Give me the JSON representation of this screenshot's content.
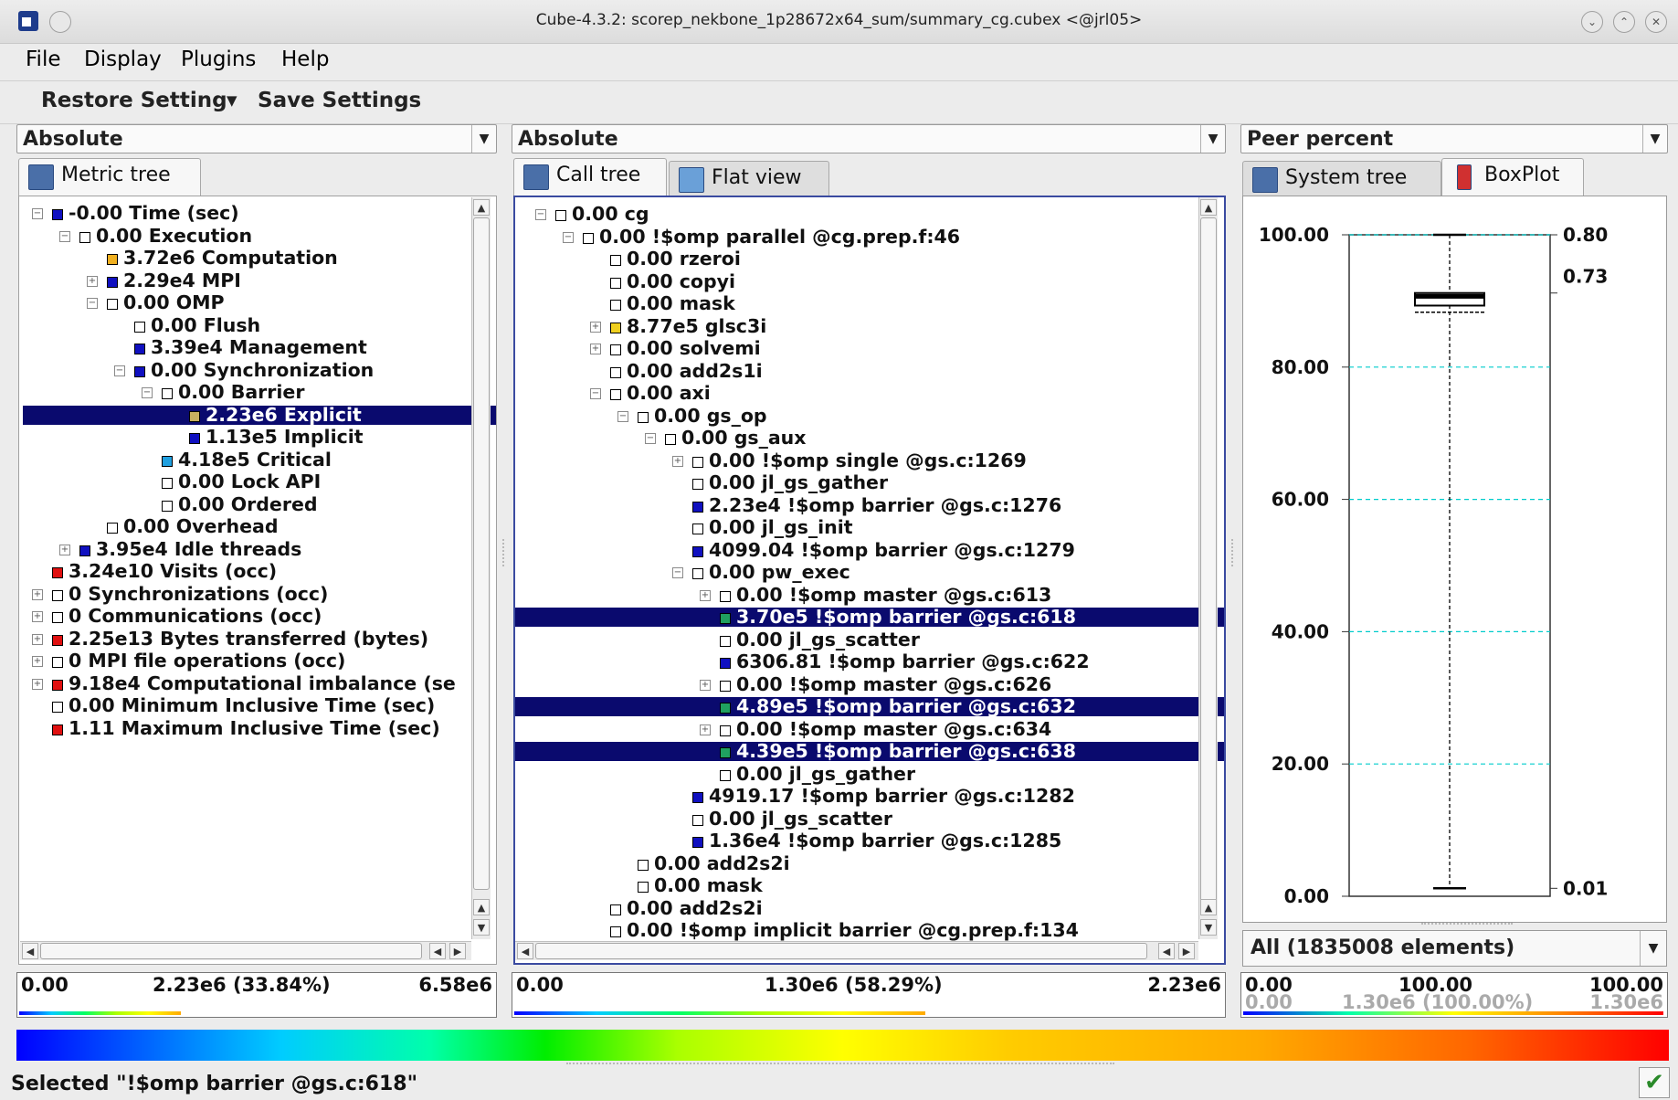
{
  "window": {
    "title": "Cube-4.3.2: scorep_nekbone_1p28672x64_sum/summary_cg.cubex <@jrl05>"
  },
  "menu": [
    "File",
    "Display",
    "Plugins",
    "Help"
  ],
  "toolbar": {
    "restore": "Restore Setting",
    "save": "Save Settings"
  },
  "metric_panel": {
    "mode": "Absolute",
    "tab": "Metric tree",
    "rows": [
      {
        "text": "-0.00 Time (sec)",
        "level": 0,
        "exp": "-",
        "color": "#1010c0"
      },
      {
        "text": "0.00 Execution",
        "level": 1,
        "exp": "-",
        "color": "#ffffff"
      },
      {
        "text": "3.72e6 Computation",
        "level": 2,
        "exp": "",
        "color": "#f0b020"
      },
      {
        "text": "2.29e4 MPI",
        "level": 2,
        "exp": "+",
        "color": "#1010c0"
      },
      {
        "text": "0.00 OMP",
        "level": 2,
        "exp": "-",
        "color": "#ffffff"
      },
      {
        "text": "0.00 Flush",
        "level": 3,
        "exp": "",
        "color": "#ffffff"
      },
      {
        "text": "3.39e4 Management",
        "level": 3,
        "exp": "",
        "color": "#1010c0"
      },
      {
        "text": "0.00 Synchronization",
        "level": 3,
        "exp": "-",
        "color": "#1010c0"
      },
      {
        "text": "0.00 Barrier",
        "level": 4,
        "exp": "-",
        "color": "#ffffff"
      },
      {
        "text": "2.23e6 Explicit",
        "level": 5,
        "exp": "",
        "color": "#c8b060",
        "selected": true
      },
      {
        "text": "1.13e5 Implicit",
        "level": 5,
        "exp": "",
        "color": "#1010c0"
      },
      {
        "text": "4.18e5 Critical",
        "level": 4,
        "exp": "",
        "color": "#20a0e0"
      },
      {
        "text": "0.00 Lock API",
        "level": 4,
        "exp": "",
        "color": "#ffffff"
      },
      {
        "text": "0.00 Ordered",
        "level": 4,
        "exp": "",
        "color": "#ffffff"
      },
      {
        "text": "0.00 Overhead",
        "level": 2,
        "exp": "",
        "color": "#ffffff"
      },
      {
        "text": "3.95e4 Idle threads",
        "level": 1,
        "exp": "+",
        "color": "#1010c0"
      },
      {
        "text": "3.24e10 Visits (occ)",
        "level": 0,
        "exp": "",
        "color": "#e01010"
      },
      {
        "text": "0 Synchronizations (occ)",
        "level": 0,
        "exp": "+",
        "color": "#ffffff"
      },
      {
        "text": "0 Communications (occ)",
        "level": 0,
        "exp": "+",
        "color": "#ffffff"
      },
      {
        "text": "2.25e13 Bytes transferred (bytes)",
        "level": 0,
        "exp": "+",
        "color": "#e01010"
      },
      {
        "text": "0 MPI file operations (occ)",
        "level": 0,
        "exp": "+",
        "color": "#ffffff"
      },
      {
        "text": "9.18e4 Computational imbalance (se",
        "level": 0,
        "exp": "+",
        "color": "#e01010"
      },
      {
        "text": "0.00 Minimum Inclusive Time (sec)",
        "level": 0,
        "exp": "",
        "color": "#ffffff"
      },
      {
        "text": "1.11 Maximum Inclusive Time (sec)",
        "level": 0,
        "exp": "",
        "color": "#e01010"
      }
    ],
    "scale": {
      "min": "0.00",
      "mid": "2.23e6 (33.84%)",
      "max": "6.58e6",
      "fill": 0.34
    }
  },
  "call_panel": {
    "mode": "Absolute",
    "tabs": [
      "Call tree",
      "Flat view"
    ],
    "rows": [
      {
        "text": "0.00 cg",
        "level": 0,
        "exp": "-",
        "color": "#ffffff"
      },
      {
        "text": "0.00 !$omp parallel @cg.prep.f:46",
        "level": 1,
        "exp": "-",
        "color": "#ffffff"
      },
      {
        "text": "0.00 rzeroi",
        "level": 2,
        "exp": "",
        "color": "#ffffff"
      },
      {
        "text": "0.00 copyi",
        "level": 2,
        "exp": "",
        "color": "#ffffff"
      },
      {
        "text": "0.00 mask",
        "level": 2,
        "exp": "",
        "color": "#ffffff"
      },
      {
        "text": "8.77e5 glsc3i",
        "level": 2,
        "exp": "+",
        "color": "#f0d020"
      },
      {
        "text": "0.00 solvemi",
        "level": 2,
        "exp": "+",
        "color": "#ffffff"
      },
      {
        "text": "0.00 add2s1i",
        "level": 2,
        "exp": "",
        "color": "#ffffff"
      },
      {
        "text": "0.00 axi",
        "level": 2,
        "exp": "-",
        "color": "#ffffff"
      },
      {
        "text": "0.00 gs_op",
        "level": 3,
        "exp": "-",
        "color": "#ffffff"
      },
      {
        "text": "0.00 gs_aux",
        "level": 4,
        "exp": "-",
        "color": "#ffffff"
      },
      {
        "text": "0.00 !$omp single @gs.c:1269",
        "level": 5,
        "exp": "+",
        "color": "#ffffff"
      },
      {
        "text": "0.00 jl_gs_gather",
        "level": 5,
        "exp": "",
        "color": "#ffffff"
      },
      {
        "text": "2.23e4 !$omp barrier @gs.c:1276",
        "level": 5,
        "exp": "",
        "color": "#1010c0"
      },
      {
        "text": "0.00 jl_gs_init",
        "level": 5,
        "exp": "",
        "color": "#ffffff"
      },
      {
        "text": "4099.04 !$omp barrier @gs.c:1279",
        "level": 5,
        "exp": "",
        "color": "#1010c0"
      },
      {
        "text": "0.00 pw_exec",
        "level": 5,
        "exp": "-",
        "color": "#ffffff"
      },
      {
        "text": "0.00 !$omp master @gs.c:613",
        "level": 6,
        "exp": "+",
        "color": "#ffffff"
      },
      {
        "text": "3.70e5 !$omp barrier @gs.c:618",
        "level": 6,
        "exp": "",
        "color": "#20a060",
        "selected": true
      },
      {
        "text": "0.00 jl_gs_scatter",
        "level": 6,
        "exp": "",
        "color": "#ffffff"
      },
      {
        "text": "6306.81 !$omp barrier @gs.c:622",
        "level": 6,
        "exp": "",
        "color": "#1010c0"
      },
      {
        "text": "0.00 !$omp master @gs.c:626",
        "level": 6,
        "exp": "+",
        "color": "#ffffff"
      },
      {
        "text": "4.89e5 !$omp barrier @gs.c:632",
        "level": 6,
        "exp": "",
        "color": "#20a060",
        "selected": true
      },
      {
        "text": "0.00 !$omp master @gs.c:634",
        "level": 6,
        "exp": "+",
        "color": "#ffffff"
      },
      {
        "text": "4.39e5 !$omp barrier @gs.c:638",
        "level": 6,
        "exp": "",
        "color": "#20a060",
        "selected": true
      },
      {
        "text": "0.00 jl_gs_gather",
        "level": 6,
        "exp": "",
        "color": "#ffffff"
      },
      {
        "text": "4919.17 !$omp barrier @gs.c:1282",
        "level": 5,
        "exp": "",
        "color": "#1010c0"
      },
      {
        "text": "0.00 jl_gs_scatter",
        "level": 5,
        "exp": "",
        "color": "#ffffff"
      },
      {
        "text": "1.36e4 !$omp barrier @gs.c:1285",
        "level": 5,
        "exp": "",
        "color": "#1010c0"
      },
      {
        "text": "0.00 add2s2i",
        "level": 3,
        "exp": "",
        "color": "#ffffff"
      },
      {
        "text": "0.00 mask",
        "level": 3,
        "exp": "",
        "color": "#ffffff"
      },
      {
        "text": "0.00 add2s2i",
        "level": 2,
        "exp": "",
        "color": "#ffffff"
      },
      {
        "text": "0.00 !$omp implicit barrier @cg.prep.f:134",
        "level": 2,
        "exp": "",
        "color": "#ffffff"
      }
    ],
    "scale": {
      "min": "0.00",
      "mid": "1.30e6 (58.29%)",
      "max": "2.23e6",
      "fill": 0.58
    }
  },
  "system_panel": {
    "mode": "Peer percent",
    "tabs": [
      "System tree",
      "BoxPlot"
    ],
    "selector": "All (1835008 elements)",
    "scale": {
      "min": "0.00",
      "mid": "100.00",
      "max": "100.00",
      "min2": "0.00",
      "mid2": "1.30e6 (100.00%)",
      "max2": "1.30e6"
    }
  },
  "chart_data": {
    "type": "boxplot",
    "ylim": [
      0,
      100
    ],
    "yticks": [
      "0.00",
      "20.00",
      "40.00",
      "60.00",
      "80.00",
      "100.00"
    ],
    "right_labels": [
      "0.80",
      "0.73",
      "0.01"
    ],
    "box": {
      "min": 1.2,
      "q1": 89.3,
      "median": 90.7,
      "mean": 88.3,
      "q3": 91.2,
      "max": 100.0
    },
    "grid": true
  },
  "status": "Selected \"!$omp barrier @gs.c:618\""
}
